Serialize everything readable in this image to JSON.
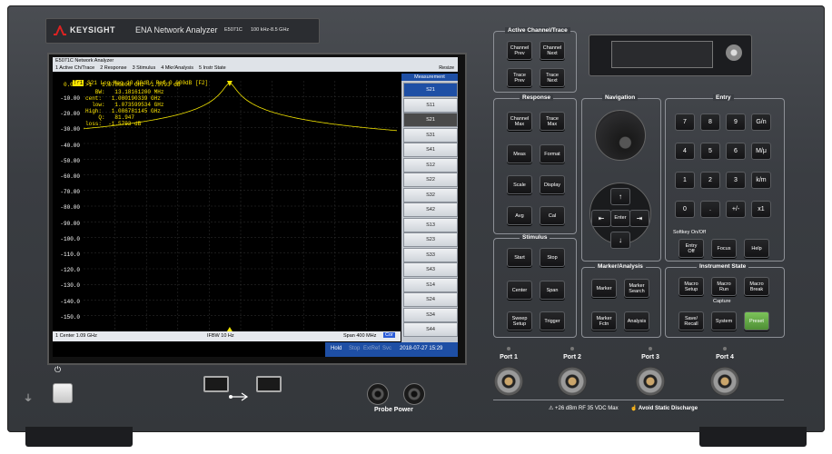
{
  "instrument": {
    "brand": "KEYSIGHT",
    "product": "ENA Network Analyzer",
    "model": "E5071C",
    "freq_range": "100 kHz-8.5 GHz"
  },
  "window": {
    "title": "E5071C Network Analyzer",
    "menu": [
      "1 Active Ch/Trace",
      "2 Response",
      "3 Stimulus",
      "4 Mkr/Analysis",
      "5 Instr State"
    ],
    "resize": "Resize"
  },
  "trace": {
    "id": "Tr1",
    "header": "S21 Log Mag 10.00dB/ Ref 0.000dB [F2]",
    "ref_value": "0.000",
    "y_ticks": [
      "-10.00",
      "-20.00",
      "-30.00",
      "-40.00",
      "-50.00",
      "-60.00",
      "-70.00",
      "-80.00",
      "-90.00",
      "-100.0",
      "-110.0",
      "-120.0",
      "-130.0",
      "-140.0",
      "-150.0"
    ],
    "marker_line": ">1   1.0780000 GHz -1.5793 dB",
    "stats": [
      "   BW:   13.18161200 MHz",
      "cent:   1.080190339 GHz",
      "  low:   1.073599534 GHz",
      "High:   1.086781145 GHz",
      "    Q:   81.947",
      "loss:  -1.5793 dB"
    ],
    "footer_left": "1  Center 1.09 GHz",
    "footer_mid": "IFBW 10 Hz",
    "footer_right": "Span 400 MHz",
    "cor": "Cor"
  },
  "softkeys": {
    "title": "Measurement",
    "items": [
      "S21",
      "S11",
      "S21",
      "S31",
      "S41",
      "S12",
      "S22",
      "S32",
      "S42",
      "S13",
      "S23",
      "S33",
      "S43",
      "S14",
      "S24",
      "S34",
      "S44"
    ],
    "selected": 2
  },
  "status": {
    "hold": "Hold",
    "stop": "Stop",
    "extref": "ExtRef",
    "svc": "Svc",
    "datetime": "2018-07-27 15:29"
  },
  "panels": {
    "active": {
      "title": "Active Channel/Trace",
      "keys": [
        "Channel\nPrev",
        "Channel\nNext",
        "Trace\nPrev",
        "Trace\nNext"
      ]
    },
    "response": {
      "title": "Response",
      "keys": [
        "Channel\nMax",
        "Trace\nMax",
        "Meas",
        "Format",
        "Scale",
        "Display",
        "Avg",
        "Cal"
      ]
    },
    "navigation": {
      "title": "Navigation",
      "enter": "Enter"
    },
    "entry": {
      "title": "Entry",
      "keys": [
        "7",
        "8",
        "9",
        "G/n",
        "4",
        "5",
        "6",
        "M/μ",
        "1",
        "2",
        "3",
        "k/m",
        "0",
        ".",
        "+/-",
        "x1"
      ],
      "softkey_label": "Softkey On/Off",
      "row": [
        "Entry\nOff",
        "Focus",
        "Help"
      ]
    },
    "stimulus": {
      "title": "Stimulus",
      "keys": [
        "Start",
        "Stop",
        "Center",
        "Span",
        "Sweep\nSetup",
        "Trigger"
      ]
    },
    "marker": {
      "title": "Marker/Analysis",
      "keys": [
        "Marker",
        "Marker\nSearch",
        "Marker\nFctn",
        "Analysis"
      ]
    },
    "instrument": {
      "title": "Instrument State",
      "keys": [
        "Macro\nSetup",
        "Macro\nRun",
        "Macro\nBreak"
      ],
      "capture": "Capture",
      "keys2": [
        "Save/\nRecall",
        "System",
        "Preset"
      ]
    }
  },
  "front": {
    "ports": [
      "Port 1",
      "Port 2",
      "Port 3",
      "Port 4"
    ],
    "warning": "+26 dBm RF  35 VDC Max",
    "discharge": "Avoid Static Discharge",
    "probe": "Probe Power",
    "power_symbol": "⏻"
  },
  "colors": {
    "trace": "#f2e400",
    "preset": "#6ab04c",
    "accent": "#d22"
  }
}
